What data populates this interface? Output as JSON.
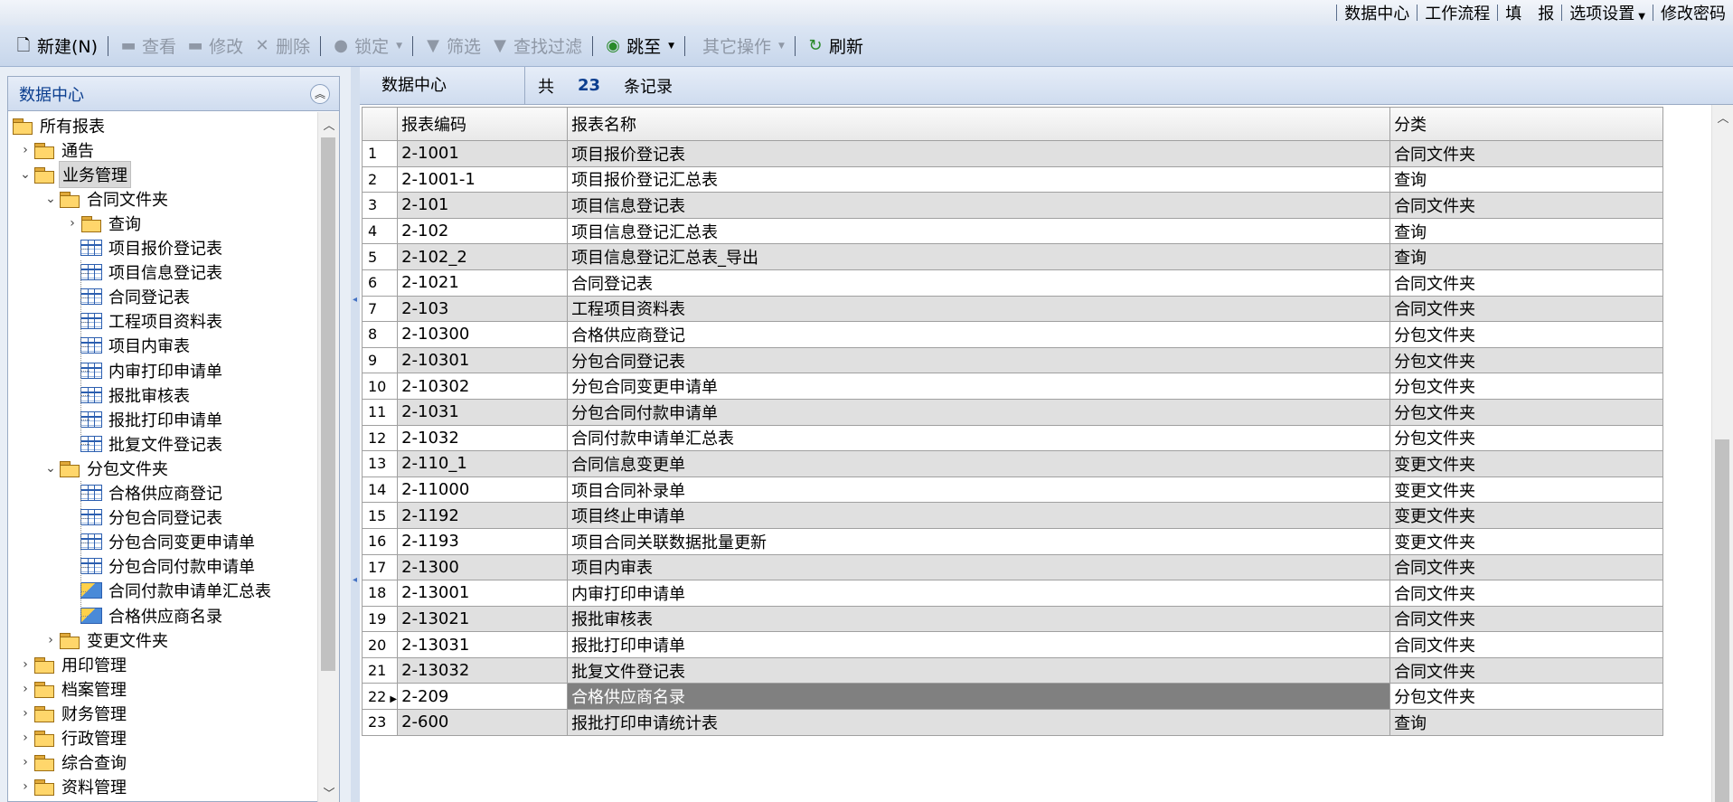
{
  "toplinks": [
    "数据中心",
    "工作流程",
    "填　报",
    "选项设置",
    "修改密码"
  ],
  "toolbar": {
    "new": "新建(N)",
    "view": "查看",
    "edit": "修改",
    "delete": "删除",
    "lock": "锁定",
    "filter": "筛选",
    "find_filter": "查找过滤",
    "goto": "跳至",
    "other": "其它操作",
    "refresh": "刷新"
  },
  "left": {
    "title": "数据中心",
    "tree": [
      {
        "label": "所有报表",
        "level": 0,
        "icon": "folder",
        "toggle": ""
      },
      {
        "label": "通告",
        "level": 1,
        "icon": "folder",
        "toggle": ">"
      },
      {
        "label": "业务管理",
        "level": 1,
        "icon": "folder",
        "toggle": "v",
        "selected": true
      },
      {
        "label": "合同文件夹",
        "level": 2,
        "icon": "folder",
        "toggle": "v"
      },
      {
        "label": "查询",
        "level": 3,
        "icon": "folder",
        "toggle": ">"
      },
      {
        "label": "项目报价登记表",
        "level": 3,
        "icon": "table",
        "toggle": ""
      },
      {
        "label": "项目信息登记表",
        "level": 3,
        "icon": "table",
        "toggle": ""
      },
      {
        "label": "合同登记表",
        "level": 3,
        "icon": "table",
        "toggle": ""
      },
      {
        "label": "工程项目资料表",
        "level": 3,
        "icon": "table",
        "toggle": ""
      },
      {
        "label": "项目内审表",
        "level": 3,
        "icon": "table",
        "toggle": ""
      },
      {
        "label": "内审打印申请单",
        "level": 3,
        "icon": "table",
        "toggle": ""
      },
      {
        "label": "报批审核表",
        "level": 3,
        "icon": "table",
        "toggle": ""
      },
      {
        "label": "报批打印申请单",
        "level": 3,
        "icon": "table",
        "toggle": ""
      },
      {
        "label": "批复文件登记表",
        "level": 3,
        "icon": "table",
        "toggle": ""
      },
      {
        "label": "分包文件夹",
        "level": 2,
        "icon": "folder",
        "toggle": "v"
      },
      {
        "label": "合格供应商登记",
        "level": 3,
        "icon": "table",
        "toggle": ""
      },
      {
        "label": "分包合同登记表",
        "level": 3,
        "icon": "table",
        "toggle": ""
      },
      {
        "label": "分包合同变更申请单",
        "level": 3,
        "icon": "table",
        "toggle": ""
      },
      {
        "label": "分包合同付款申请单",
        "level": 3,
        "icon": "table",
        "toggle": ""
      },
      {
        "label": "合同付款申请单汇总表",
        "level": 3,
        "icon": "report",
        "toggle": ""
      },
      {
        "label": "合格供应商名录",
        "level": 3,
        "icon": "report",
        "toggle": ""
      },
      {
        "label": "变更文件夹",
        "level": 2,
        "icon": "folder",
        "toggle": ">"
      },
      {
        "label": "用印管理",
        "level": 1,
        "icon": "folder",
        "toggle": ">"
      },
      {
        "label": "档案管理",
        "level": 1,
        "icon": "folder",
        "toggle": ">"
      },
      {
        "label": "财务管理",
        "level": 1,
        "icon": "folder",
        "toggle": ">"
      },
      {
        "label": "行政管理",
        "level": 1,
        "icon": "folder",
        "toggle": ">"
      },
      {
        "label": "综合查询",
        "level": 1,
        "icon": "folder",
        "toggle": ">"
      },
      {
        "label": "资料管理",
        "level": 1,
        "icon": "folder",
        "toggle": ">"
      }
    ]
  },
  "right": {
    "title": "数据中心",
    "total_prefix": "共",
    "count": "23",
    "total_suffix": "条记录",
    "columns": [
      "报表编码",
      "报表名称",
      "分类"
    ],
    "rows": [
      [
        "2-1001",
        "项目报价登记表",
        "合同文件夹"
      ],
      [
        "2-1001-1",
        "项目报价登记汇总表",
        "查询"
      ],
      [
        "2-101",
        "项目信息登记表",
        "合同文件夹"
      ],
      [
        "2-102",
        "项目信息登记汇总表",
        "查询"
      ],
      [
        "2-102_2",
        "项目信息登记汇总表_导出",
        "查询"
      ],
      [
        "2-1021",
        "合同登记表",
        "合同文件夹"
      ],
      [
        "2-103",
        "工程项目资料表",
        "合同文件夹"
      ],
      [
        "2-10300",
        "合格供应商登记",
        "分包文件夹"
      ],
      [
        "2-10301",
        "分包合同登记表",
        "分包文件夹"
      ],
      [
        "2-10302",
        "分包合同变更申请单",
        "分包文件夹"
      ],
      [
        "2-1031",
        "分包合同付款申请单",
        "分包文件夹"
      ],
      [
        "2-1032",
        "合同付款申请单汇总表",
        "分包文件夹"
      ],
      [
        "2-110_1",
        "合同信息变更单",
        "变更文件夹"
      ],
      [
        "2-11000",
        "项目合同补录单",
        "变更文件夹"
      ],
      [
        "2-1192",
        "项目终止申请单",
        "变更文件夹"
      ],
      [
        "2-1193",
        "项目合同关联数据批量更新",
        "变更文件夹"
      ],
      [
        "2-1300",
        "项目内审表",
        "合同文件夹"
      ],
      [
        "2-13001",
        "内审打印申请单",
        "合同文件夹"
      ],
      [
        "2-13021",
        "报批审核表",
        "合同文件夹"
      ],
      [
        "2-13031",
        "报批打印申请单",
        "合同文件夹"
      ],
      [
        "2-13032",
        "批复文件登记表",
        "合同文件夹"
      ],
      [
        "2-209",
        "合格供应商名录",
        "分包文件夹"
      ],
      [
        "2-600",
        "报批打印申请统计表",
        "查询"
      ]
    ],
    "selected_row": 22
  }
}
